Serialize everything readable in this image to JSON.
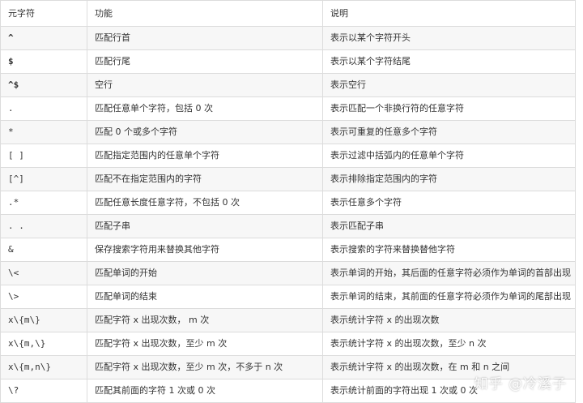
{
  "table": {
    "headers": [
      "元字符",
      "功能",
      "说明"
    ],
    "rows": [
      [
        "^",
        "匹配行首",
        "表示以某个字符开头"
      ],
      [
        "$",
        "匹配行尾",
        "表示以某个字符结尾"
      ],
      [
        "^$",
        "空行",
        "表示空行"
      ],
      [
        ".",
        "匹配任意单个字符，包括 0 次",
        "表示匹配一个非换行符的任意字符"
      ],
      [
        "*",
        "匹配 0 个或多个字符",
        "表示可重复的任意多个字符"
      ],
      [
        "[ ]",
        "匹配指定范围内的任意单个字符",
        "表示过滤中括弧内的任意单个字符"
      ],
      [
        "[^]",
        "匹配不在指定范围内的字符",
        "表示排除指定范围内的字符"
      ],
      [
        ".*",
        "匹配任意长度任意字符，不包括 0 次",
        "表示任意多个字符"
      ],
      [
        ". .",
        "匹配子串",
        "表示匹配子串"
      ],
      [
        "&",
        "保存搜索字符用来替换其他字符",
        "表示搜索的字符来替换替他字符"
      ],
      [
        "\\<",
        "匹配单词的开始",
        "表示单词的开始，其后面的任意字符必须作为单词的首部出现"
      ],
      [
        "\\>",
        "匹配单词的结束",
        "表示单词的结束，其前面的任意字符必须作为单词的尾部出现"
      ],
      [
        "x\\{m\\}",
        "匹配字符 x 出现次数， m 次",
        "表示统计字符 x 的出现次数"
      ],
      [
        "x\\{m,\\}",
        "匹配字符 x 出现次数，至少 m 次",
        "表示统计字符 x 的出现次数，至少 n 次"
      ],
      [
        "x\\{m,n\\}",
        "匹配字符 x 出现次数，至少 m 次，不多于 n 次",
        "表示统计字符 x 的出现次数，在 m 和 n 之间"
      ],
      [
        "\\?",
        "匹配其前面的字符 1 次或 0 次",
        "表示统计前面的字符出现 1 次或 0 次"
      ]
    ]
  },
  "watermark": "知乎 @冷溪子"
}
